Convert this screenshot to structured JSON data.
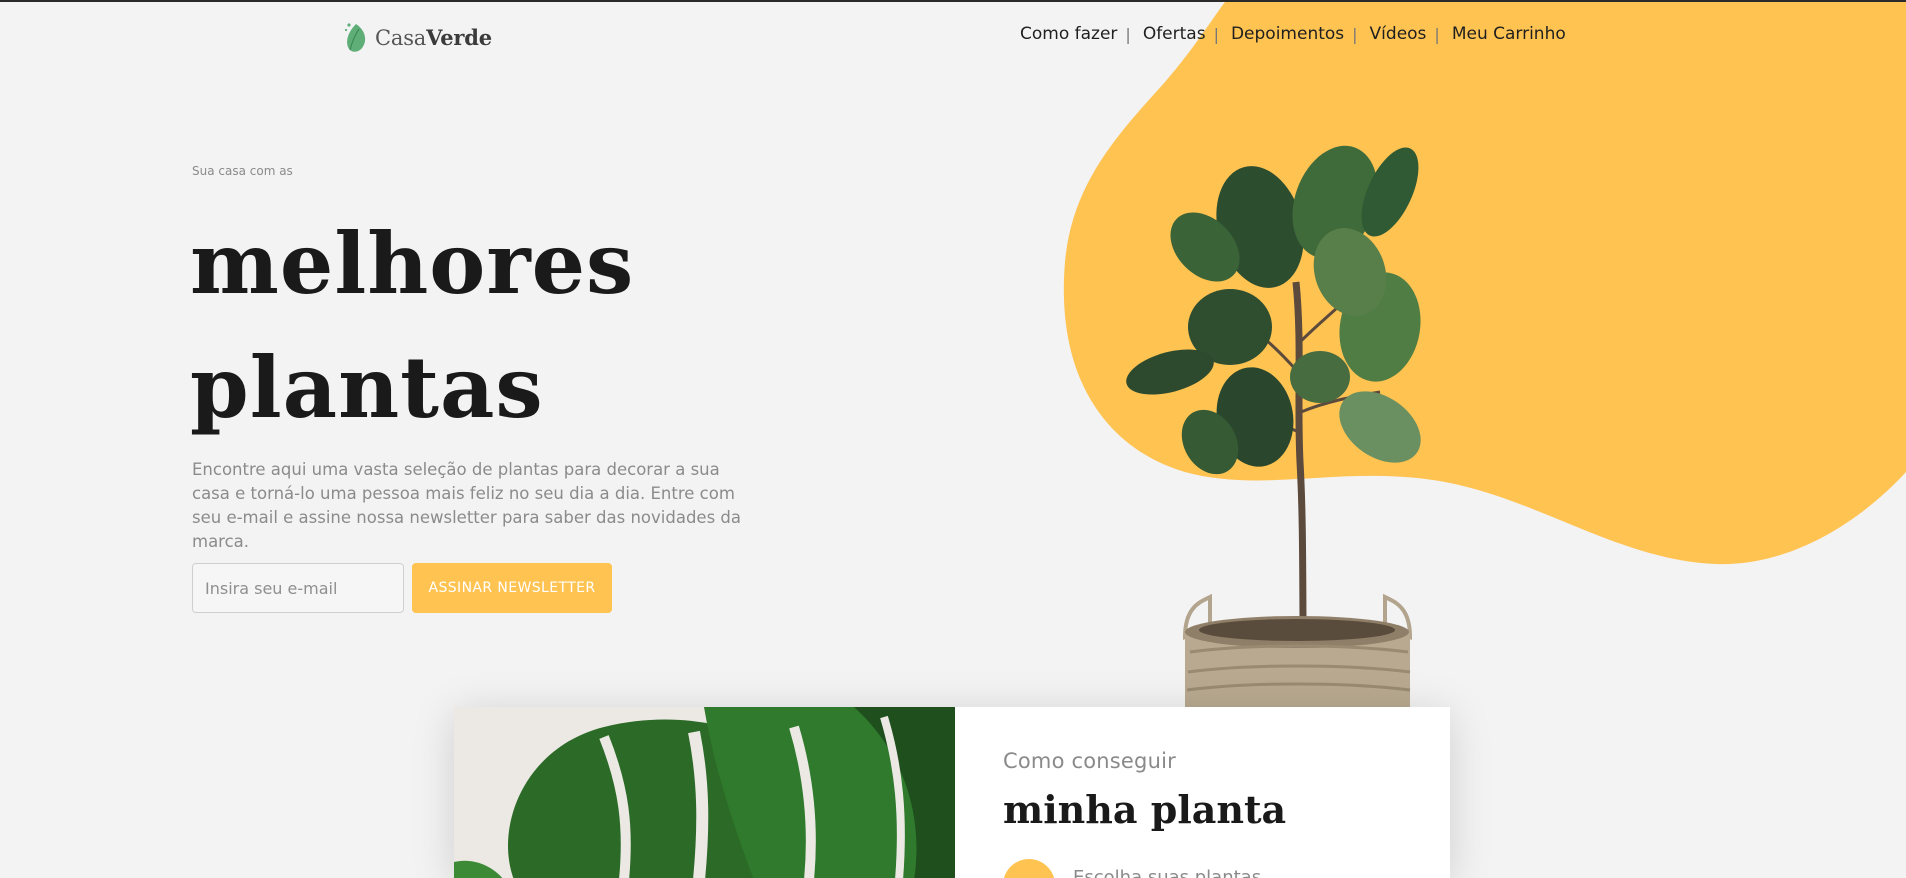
{
  "brand": {
    "name_part1": "Casa",
    "name_part2": "Verde",
    "icon": "leaf-icon",
    "accent_color": "#ffc352",
    "green_color": "#5fae78"
  },
  "nav": {
    "items": [
      {
        "label": "Como fazer"
      },
      {
        "label": "Ofertas"
      },
      {
        "label": "Depoimentos"
      },
      {
        "label": "Vídeos"
      },
      {
        "label": "Meu Carrinho"
      }
    ],
    "separator": "|"
  },
  "hero": {
    "eyebrow": "Sua casa com as",
    "headline_line1": "melhores",
    "headline_line2": "plantas",
    "description": "Encontre aqui uma vasta seleção de plantas para decorar a sua casa e torná-lo uma pessoa mais feliz no seu dia a dia. Entre com seu e-mail e assine nossa newsletter para saber das novidades da marca.",
    "email_placeholder": "Insira seu e-mail",
    "email_value": "",
    "subscribe_label": "ASSINAR NEWSLETTER",
    "image": "fiddle-leaf-fig-plant-in-basket"
  },
  "how_to": {
    "image": "monstera-leaves",
    "subtitle": "Como conseguir",
    "title": "minha planta",
    "first_step_partial": "Escolha suas plantas"
  }
}
